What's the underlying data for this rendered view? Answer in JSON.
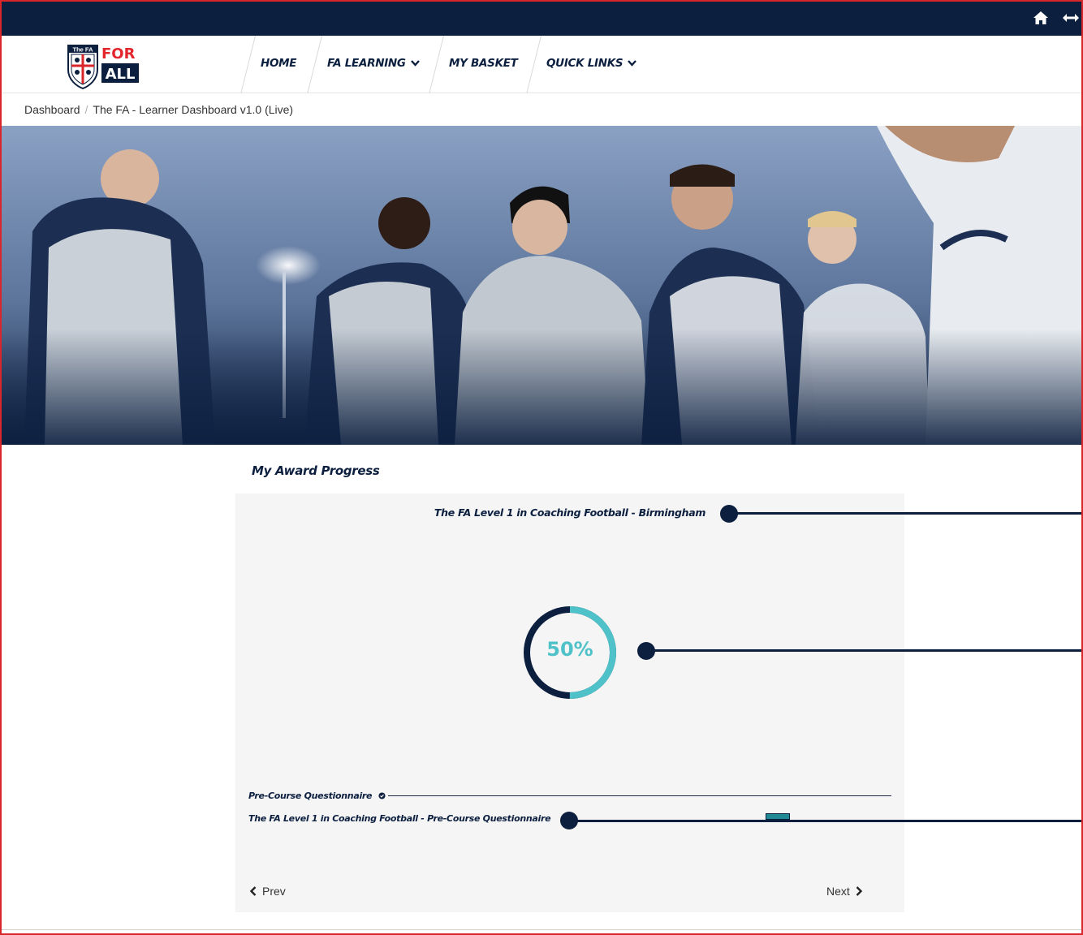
{
  "header": {
    "home_icon": "home-icon",
    "expand_icon": "expand-arrows-icon"
  },
  "nav": {
    "logo_badge": "The FA",
    "logo_word1": "FOR",
    "logo_word2": "ALL",
    "items": [
      {
        "label": "HOME"
      },
      {
        "label": "FA LEARNING"
      },
      {
        "label": "MY BASKET"
      },
      {
        "label": "QUICK LINKS"
      }
    ]
  },
  "breadcrumb": {
    "items": [
      "Dashboard",
      "The FA - Learner Dashboard v1.0 (Live)"
    ],
    "separator": "/"
  },
  "award": {
    "section_title": "My Award Progress",
    "name": "The FA Level 1 in Coaching Football - Birmingham",
    "progress_label": "50%",
    "progress_fraction": 0.5,
    "step_title": "Pre-Course Questionnaire",
    "step_detail": "The FA Level 1 in Coaching Football - Pre-Course Questionnaire",
    "prev_label": "Prev",
    "next_label": "Next"
  },
  "colors": {
    "navy": "#0c1f3f",
    "teal": "#4fc1c8",
    "accent_red": "#e3262d",
    "frame_red": "#d9262b"
  }
}
